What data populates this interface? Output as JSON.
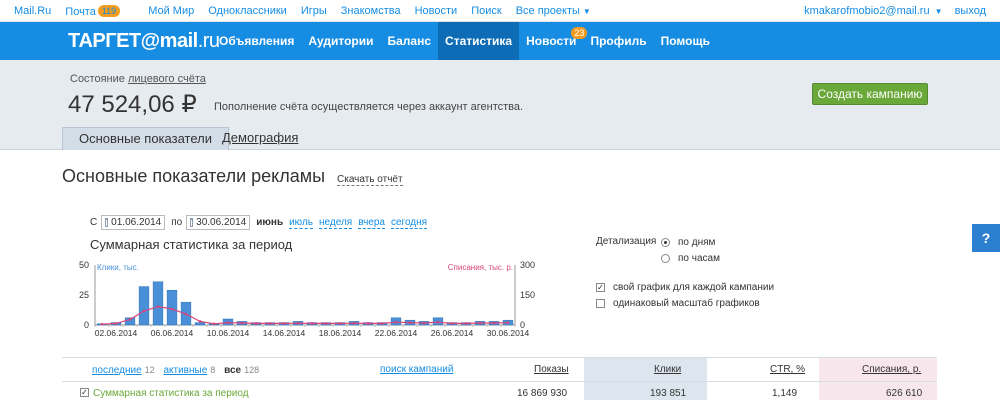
{
  "portal": {
    "links": [
      "Mail.Ru",
      "Почта",
      "Мой Мир",
      "Одноклассники",
      "Игры",
      "Знакомства",
      "Новости",
      "Поиск",
      "Все проекты"
    ],
    "mail_badge": "119",
    "user": "kmakarofmobio2@mail.ru",
    "logout": "выход"
  },
  "header": {
    "logo_prefix": "ТАРГЕТ",
    "logo_at": "@",
    "logo_mail": "mail",
    "logo_dom": ".ru",
    "nav": [
      "Объявления",
      "Аудитории",
      "Баланс",
      "Статистика",
      "Новости",
      "Профиль",
      "Помощь"
    ],
    "news_badge": "23",
    "active": "Статистика"
  },
  "account": {
    "label_prefix": "Состояние ",
    "label_link": "лицевого счёта",
    "balance": "47 524,06 ₽",
    "note": "Пополнение счёта осуществляется через аккаунт агентства.",
    "create_button": "Создать кампанию"
  },
  "tabs": {
    "main": "Основные показатели",
    "demography": "Демография"
  },
  "page": {
    "title": "Основные показатели рекламы",
    "download": "Скачать отчёт"
  },
  "dates": {
    "from_label": "С",
    "from": "01.06.2014",
    "to_label": "по",
    "to": "30.06.2014",
    "current": "июнь",
    "quick": [
      "июль",
      "неделя",
      "вчера",
      "сегодня"
    ]
  },
  "detail": {
    "label": "Детализация",
    "by_days": "по дням",
    "by_hours": "по часам",
    "own_chart": "свой график для каждой кампании",
    "same_scale": "одинаковый масштаб графиков"
  },
  "help_label": "?",
  "chart_data": {
    "type": "bar",
    "title": "Суммарная статистика за период",
    "left_axis_label": "Клики, тыс.",
    "right_axis_label": "Списания, тыс. р.",
    "left_ticks": [
      "50",
      "25",
      "0"
    ],
    "right_ticks": [
      "300",
      "150",
      "0"
    ],
    "ylim_left": [
      0,
      50
    ],
    "ylim_right": [
      0,
      300
    ],
    "x_tick_labels": [
      "02.06.2014",
      "06.06.2014",
      "10.06.2014",
      "14.06.2014",
      "18.06.2014",
      "22.06.2014",
      "26.06.2014",
      "30.06.2014"
    ],
    "days": [
      1,
      2,
      3,
      4,
      5,
      6,
      7,
      8,
      9,
      10,
      11,
      12,
      13,
      14,
      15,
      16,
      17,
      18,
      19,
      20,
      21,
      22,
      23,
      24,
      25,
      26,
      27,
      28,
      29,
      30
    ],
    "series": [
      {
        "name": "Клики, тыс.",
        "color": "#4a90d9",
        "values": [
          1,
          2,
          6,
          32,
          36,
          29,
          19,
          2,
          1,
          5,
          3,
          2,
          2,
          2,
          3,
          2,
          2,
          2,
          3,
          2,
          2,
          6,
          4,
          3,
          6,
          2,
          2,
          3,
          3,
          4
        ]
      },
      {
        "name": "Списания, тыс. р.",
        "color": "#d9457a",
        "values": [
          4,
          8,
          28,
          70,
          92,
          80,
          55,
          18,
          6,
          12,
          10,
          8,
          8,
          8,
          9,
          8,
          8,
          8,
          9,
          8,
          8,
          14,
          12,
          10,
          14,
          8,
          8,
          10,
          10,
          12
        ]
      }
    ]
  },
  "table": {
    "filter_recent": "последние",
    "recent_count": "12",
    "filter_active": "активные",
    "active_count": "8",
    "filter_all": "все",
    "all_count": "128",
    "search": "поиск кампаний",
    "columns": [
      "Показы",
      "Клики",
      "CTR, %",
      "Списания, р."
    ],
    "summary_label": "Суммарная статистика за период",
    "summary_values": [
      "16 869 930",
      "193 851",
      "1,149",
      "626 610"
    ]
  }
}
